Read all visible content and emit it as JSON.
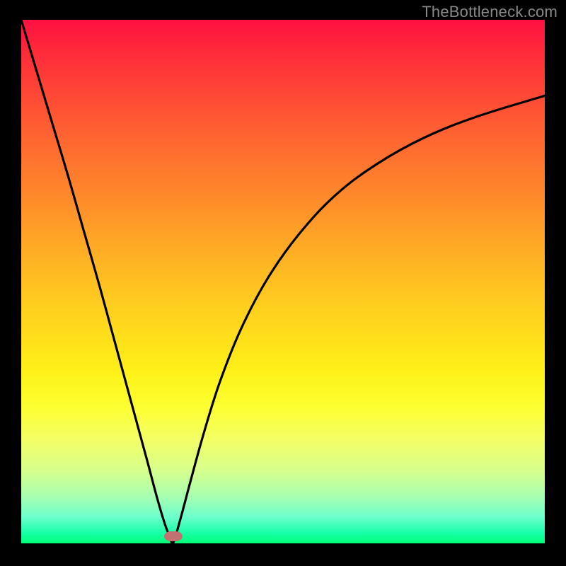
{
  "attribution": "TheBottleneck.com",
  "chart_data": {
    "type": "line",
    "title": "",
    "xlabel": "",
    "ylabel": "",
    "xlim": [
      0,
      1
    ],
    "ylim": [
      0,
      1
    ],
    "series": [
      {
        "name": "left-branch",
        "x": [
          0.0,
          0.03,
          0.06,
          0.09,
          0.12,
          0.15,
          0.18,
          0.21,
          0.24,
          0.26,
          0.275,
          0.285,
          0.29
        ],
        "y": [
          1.0,
          0.9,
          0.8,
          0.7,
          0.595,
          0.49,
          0.38,
          0.27,
          0.16,
          0.085,
          0.035,
          0.01,
          0.0
        ]
      },
      {
        "name": "right-branch",
        "x": [
          0.29,
          0.305,
          0.325,
          0.35,
          0.38,
          0.42,
          0.47,
          0.53,
          0.6,
          0.68,
          0.77,
          0.87,
          1.0
        ],
        "y": [
          0.0,
          0.05,
          0.125,
          0.215,
          0.31,
          0.41,
          0.505,
          0.59,
          0.665,
          0.725,
          0.775,
          0.815,
          0.855
        ]
      }
    ],
    "marker": {
      "x": 0.29,
      "y": 0.013,
      "color": "#c37070"
    },
    "gradient_stops": [
      {
        "pos": 0.0,
        "color": "#ff1040"
      },
      {
        "pos": 0.5,
        "color": "#ffd21e"
      },
      {
        "pos": 0.78,
        "color": "#fdff30"
      },
      {
        "pos": 1.0,
        "color": "#00ff77"
      }
    ]
  }
}
